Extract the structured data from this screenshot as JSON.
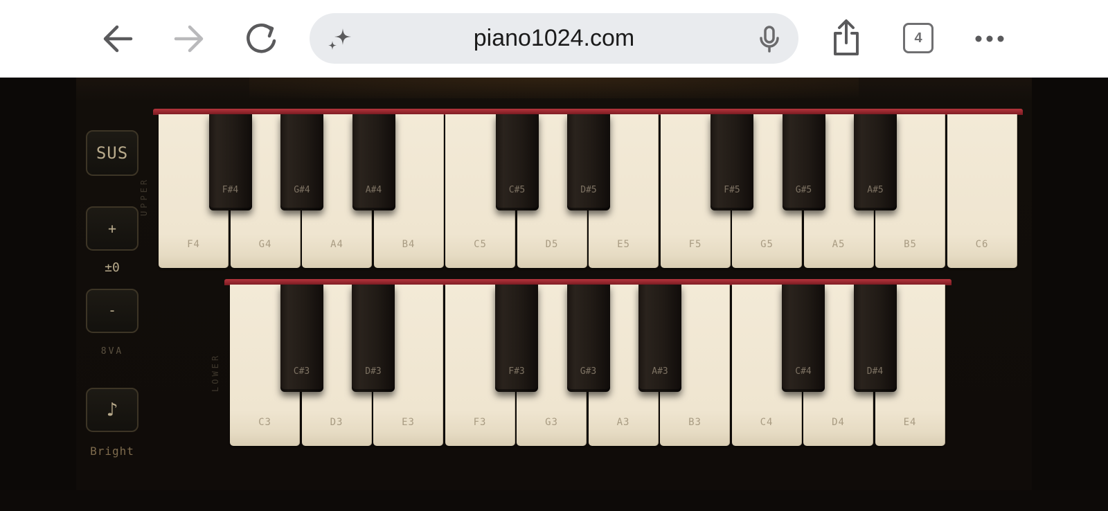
{
  "browser": {
    "url": "piano1024.com",
    "tab_count": "4"
  },
  "controls": {
    "sustain_label": "SUS",
    "octave_up_label": "+",
    "octave_value": "±0",
    "octave_down_label": "-",
    "octave_caption": "8VA",
    "tone_symbol": "♪",
    "tone_label": "Bright"
  },
  "upper": {
    "label": "UPPER",
    "white_keys": [
      "F4",
      "G4",
      "A4",
      "B4",
      "C5",
      "D5",
      "E5",
      "F5",
      "G5",
      "A5",
      "B5",
      "C6"
    ],
    "black_keys": [
      {
        "note": "F#4",
        "after_white": 0
      },
      {
        "note": "G#4",
        "after_white": 1
      },
      {
        "note": "A#4",
        "after_white": 2
      },
      {
        "note": "C#5",
        "after_white": 4
      },
      {
        "note": "D#5",
        "after_white": 5
      },
      {
        "note": "F#5",
        "after_white": 7
      },
      {
        "note": "G#5",
        "after_white": 8
      },
      {
        "note": "A#5",
        "after_white": 9
      }
    ]
  },
  "lower": {
    "label": "LOWER",
    "white_keys": [
      "C3",
      "D3",
      "E3",
      "F3",
      "G3",
      "A3",
      "B3",
      "C4",
      "D4",
      "E4"
    ],
    "black_keys": [
      {
        "note": "C#3",
        "after_white": 0
      },
      {
        "note": "D#3",
        "after_white": 1
      },
      {
        "note": "F#3",
        "after_white": 3
      },
      {
        "note": "G#3",
        "after_white": 4
      },
      {
        "note": "A#3",
        "after_white": 5
      },
      {
        "note": "C#4",
        "after_white": 7
      },
      {
        "note": "D#4",
        "after_white": 8
      }
    ]
  }
}
